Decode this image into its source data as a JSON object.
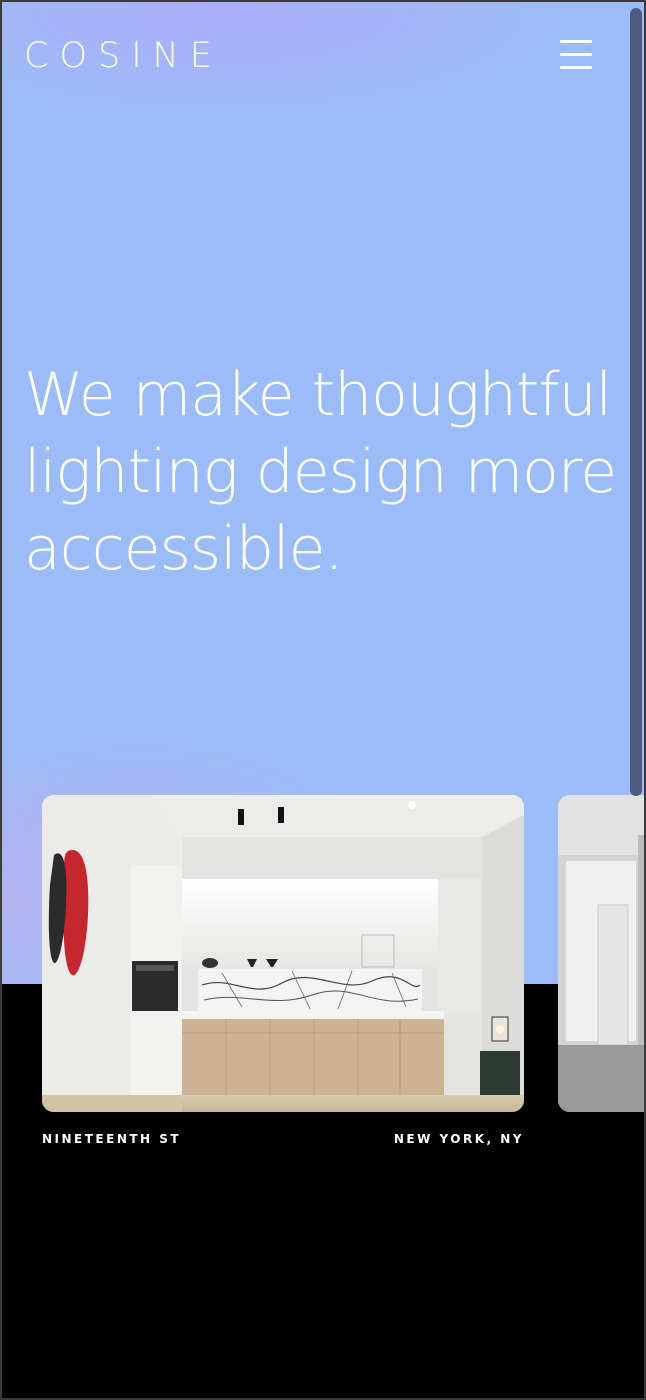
{
  "brand": {
    "logo_text": "COSINE",
    "menu_icon": "hamburger-menu-icon"
  },
  "hero": {
    "headline_lines": [
      "We make thoughtful",
      "lighting design more",
      "accessible."
    ],
    "background_color": "#9cbcf7"
  },
  "projects": [
    {
      "title": "NINETEENTH ST",
      "location": "NEW YORK, NY"
    }
  ],
  "colors": {
    "accent": "#9cbcf7",
    "lower_background": "#000000",
    "text": "#ffffff"
  }
}
